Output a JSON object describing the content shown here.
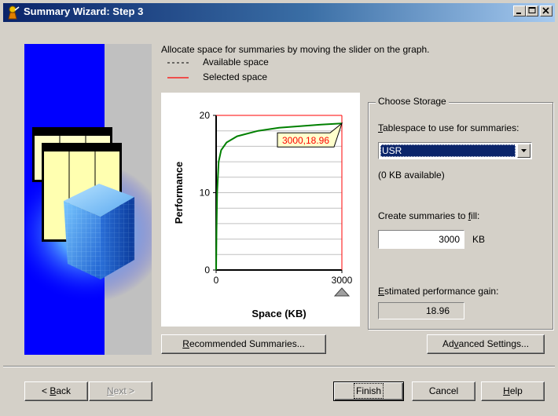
{
  "window": {
    "title": "Summary Wizard: Step 3",
    "minimize_glyph": "_",
    "restore_glyph": "□",
    "close_glyph": "×"
  },
  "intro": {
    "text": "Allocate space for summaries by moving the slider on the graph."
  },
  "legend": {
    "available": "Available space",
    "selected": "Selected space",
    "available_color": "#000000",
    "selected_color": "#ff0000"
  },
  "chart_data": {
    "type": "line",
    "xlabel": "Space (KB)",
    "ylabel": "Performance",
    "x_ticks": [
      "0",
      "3000"
    ],
    "y_ticks": [
      "0",
      "10",
      "20"
    ],
    "xlim": [
      0,
      3000
    ],
    "ylim": [
      0,
      20
    ],
    "series": [
      {
        "color": "#008000",
        "points": [
          [
            0,
            0
          ],
          [
            10,
            5
          ],
          [
            25,
            10
          ],
          [
            60,
            14
          ],
          [
            120,
            15.5
          ],
          [
            250,
            16.5
          ],
          [
            500,
            17.3
          ],
          [
            1000,
            18
          ],
          [
            1500,
            18.4
          ],
          [
            2000,
            18.6
          ],
          [
            2500,
            18.8
          ],
          [
            3000,
            18.96
          ]
        ]
      }
    ],
    "selected_marker": {
      "x": 3000,
      "y": 18.96,
      "label": "3000,18.96"
    },
    "grid": true,
    "slider_color": "#ff0000"
  },
  "storage": {
    "group_title": "Choose Storage",
    "tablespace_label_underlined": "T",
    "tablespace_label_rest": "ablespace to use for summaries:",
    "tablespace_value": "USR",
    "available_text": "(0 KB available)",
    "fill_label_prefix": "Create summaries to ",
    "fill_label_underlined": "f",
    "fill_label_suffix": "ill:",
    "fill_value": "3000",
    "fill_unit": "KB",
    "gain_label_underlined": "E",
    "gain_label_rest": "stimated performance gain:",
    "gain_value": "18.96"
  },
  "buttons": {
    "recommended_underlined": "R",
    "recommended_rest": "ecommended Summaries...",
    "advanced_prefix": "Ad",
    "advanced_underlined": "v",
    "advanced_rest": "anced Settings...",
    "back_prefix": "< ",
    "back_underlined": "B",
    "back_rest": "ack",
    "next_underlined": "N",
    "next_rest": "ext >",
    "finish": "Finish",
    "cancel": "Cancel",
    "help_underlined": "H",
    "help_rest": "elp"
  }
}
